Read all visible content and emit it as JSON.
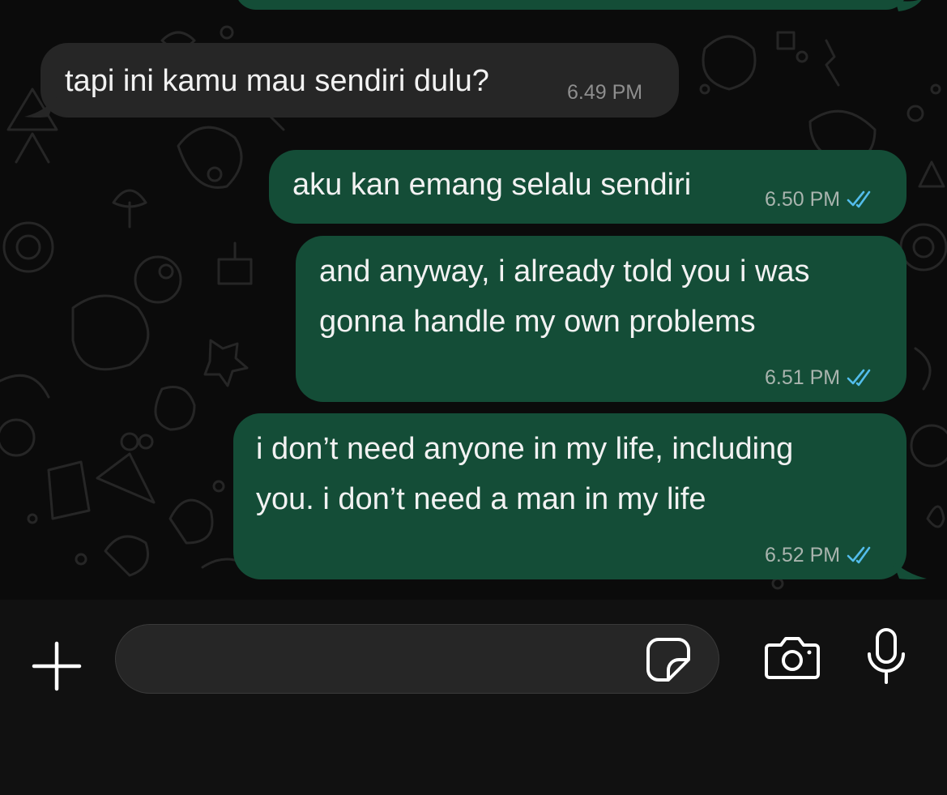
{
  "messages": [
    {
      "direction": "incoming",
      "text_lines": [
        "tapi ini kamu mau sendiri dulu?"
      ],
      "time": "6.49 PM",
      "read": false
    },
    {
      "direction": "outgoing",
      "text_lines": [
        "aku kan emang selalu sendiri"
      ],
      "time": "6.50 PM",
      "read": true
    },
    {
      "direction": "outgoing",
      "text_lines": [
        "and anyway, i already told you i was",
        "gonna handle my own problems"
      ],
      "time": "6.51 PM",
      "read": true
    },
    {
      "direction": "outgoing",
      "text_lines": [
        "i don’t need anyone in my life, including",
        "you. i don’t need a man in my life"
      ],
      "time": "6.52 PM",
      "read": true
    }
  ],
  "composer": {
    "input_value": "",
    "icons": [
      "plus-icon",
      "sticker-icon",
      "camera-icon",
      "microphone-icon"
    ]
  },
  "colors": {
    "background": "#0b0b0b",
    "incoming_bubble": "#262626",
    "outgoing_bubble": "#144d37",
    "read_ticks": "#53bdeb",
    "composer_bg": "#111111"
  }
}
